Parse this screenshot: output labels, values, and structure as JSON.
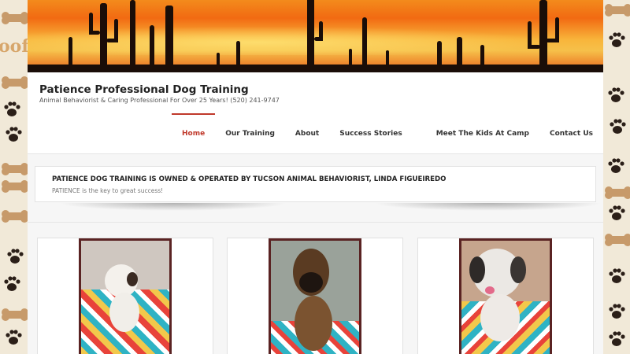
{
  "site": {
    "title": "Patience Professional Dog Training",
    "tagline": "Animal Behaviorist & Caring Professional For Over 25 Years! (520) 241-9747"
  },
  "nav": {
    "items": [
      {
        "label": "Home",
        "active": true
      },
      {
        "label": "Our Training",
        "active": false
      },
      {
        "label": "About",
        "active": false
      },
      {
        "label": "Success Stories",
        "active": false
      },
      {
        "label": "Meet The Kids At Camp",
        "active": false
      },
      {
        "label": "Contact Us",
        "active": false
      }
    ]
  },
  "intro": {
    "title": "PATIENCE DOG TRAINING IS OWNED & OPERATED BY TUCSON ANIMAL BEHAVIORIST, LINDA FIGUEIREDO",
    "subtitle": "PATIENCE is the key to great success!"
  },
  "background": {
    "woof_text": "oof"
  },
  "colors": {
    "accent": "#c0392b",
    "photo_frame": "#5a2323",
    "page_bg": "#f6f6f6"
  },
  "cards": [
    {
      "icon": "dog-photo-white-puppy"
    },
    {
      "icon": "dog-photo-malinois"
    },
    {
      "icon": "dog-photo-shih-tzu"
    }
  ]
}
